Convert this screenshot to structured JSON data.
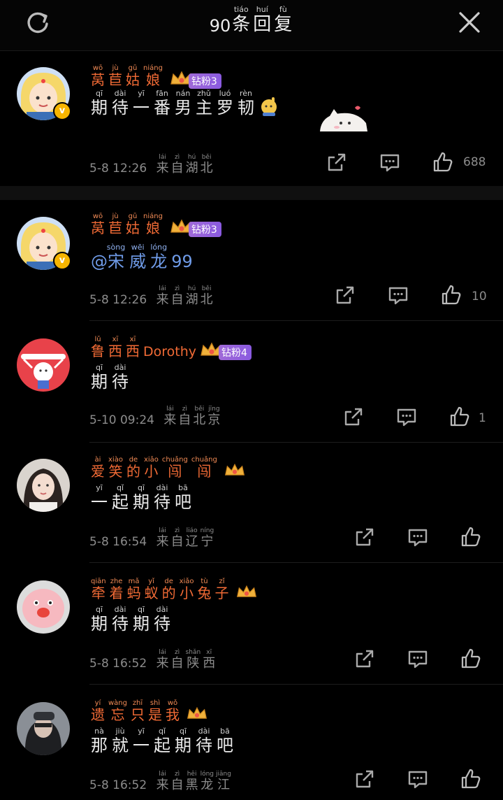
{
  "header": {
    "count": "90",
    "title": [
      {
        "ch": "条",
        "py": "tiáo"
      },
      {
        "ch": "回",
        "py": "huí"
      },
      {
        "ch": "复",
        "py": "fù"
      }
    ]
  },
  "comments": [
    {
      "name": [
        {
          "ch": "莴",
          "py": "wō"
        },
        {
          "ch": "苣",
          "py": "jù"
        },
        {
          "ch": "姑",
          "py": "gū"
        },
        {
          "ch": "娘",
          "py": "niáng"
        }
      ],
      "fan_badge": "钻粉3",
      "text": [
        {
          "ch": "期",
          "py": "qī"
        },
        {
          "ch": "待",
          "py": "dài"
        },
        {
          "ch": "一",
          "py": "yī"
        },
        {
          "ch": "番",
          "py": "fān"
        },
        {
          "ch": "男",
          "py": "nán"
        },
        {
          "ch": "主",
          "py": "zhǔ"
        },
        {
          "ch": "罗",
          "py": "luó"
        },
        {
          "ch": "韧",
          "py": "rèn"
        }
      ],
      "time": "5-8 12:26",
      "location": [
        {
          "ch": "来",
          "py": "lái"
        },
        {
          "ch": "自",
          "py": "zì"
        },
        {
          "ch": "湖",
          "py": "hú"
        },
        {
          "ch": "北",
          "py": "běi"
        }
      ],
      "likes": "688"
    },
    {
      "name": [
        {
          "ch": "莴",
          "py": "wō"
        },
        {
          "ch": "苣",
          "py": "jù"
        },
        {
          "ch": "姑",
          "py": "gū"
        },
        {
          "ch": "娘",
          "py": "niáng"
        }
      ],
      "fan_badge": "钻粉3",
      "text_prefix": "@",
      "text": [
        {
          "ch": "宋",
          "py": "sòng"
        },
        {
          "ch": "威",
          "py": "wēi"
        },
        {
          "ch": "龙",
          "py": "lóng"
        }
      ],
      "text_suffix": "99",
      "time": "5-8 12:26",
      "location": [
        {
          "ch": "来",
          "py": "lái"
        },
        {
          "ch": "自",
          "py": "zì"
        },
        {
          "ch": "湖",
          "py": "hú"
        },
        {
          "ch": "北",
          "py": "běi"
        }
      ],
      "likes": "10"
    },
    {
      "name": [
        {
          "ch": "鲁",
          "py": "lǔ"
        },
        {
          "ch": "西",
          "py": "xī"
        },
        {
          "ch": "西",
          "py": "xī"
        }
      ],
      "name_suffix": "Dorothy",
      "fan_badge": "钻粉4",
      "text": [
        {
          "ch": "期",
          "py": "qī"
        },
        {
          "ch": "待",
          "py": "dài"
        }
      ],
      "time": "5-10 09:24",
      "location": [
        {
          "ch": "来",
          "py": "lái"
        },
        {
          "ch": "自",
          "py": "zì"
        },
        {
          "ch": "北",
          "py": "běi"
        },
        {
          "ch": "京",
          "py": "jīng"
        }
      ],
      "likes": "1"
    },
    {
      "name": [
        {
          "ch": "爱",
          "py": "ài"
        },
        {
          "ch": "笑",
          "py": "xiào"
        },
        {
          "ch": "的",
          "py": "de"
        },
        {
          "ch": "小",
          "py": "xiǎo"
        },
        {
          "ch": "闯",
          "py": "chuǎng"
        },
        {
          "ch": "闯",
          "py": "chuǎng"
        }
      ],
      "text": [
        {
          "ch": "一",
          "py": "yī"
        },
        {
          "ch": "起",
          "py": "qǐ"
        },
        {
          "ch": "期",
          "py": "qī"
        },
        {
          "ch": "待",
          "py": "dài"
        },
        {
          "ch": "吧",
          "py": "bā"
        }
      ],
      "time": "5-8 16:54",
      "location": [
        {
          "ch": "来",
          "py": "lái"
        },
        {
          "ch": "自",
          "py": "zì"
        },
        {
          "ch": "辽",
          "py": "liáo"
        },
        {
          "ch": "宁",
          "py": "níng"
        }
      ],
      "likes": ""
    },
    {
      "name": [
        {
          "ch": "牵",
          "py": "qiān"
        },
        {
          "ch": "着",
          "py": "zhe"
        },
        {
          "ch": "蚂",
          "py": "mǎ"
        },
        {
          "ch": "蚁",
          "py": "yǐ"
        },
        {
          "ch": "的",
          "py": "de"
        },
        {
          "ch": "小",
          "py": "xiǎo"
        },
        {
          "ch": "兔",
          "py": "tù"
        },
        {
          "ch": "子",
          "py": "zǐ"
        }
      ],
      "text": [
        {
          "ch": "期",
          "py": "qī"
        },
        {
          "ch": "待",
          "py": "dài"
        },
        {
          "ch": "期",
          "py": "qī"
        },
        {
          "ch": "待",
          "py": "dài"
        }
      ],
      "time": "5-8 16:52",
      "location": [
        {
          "ch": "来",
          "py": "lái"
        },
        {
          "ch": "自",
          "py": "zì"
        },
        {
          "ch": "陕",
          "py": "shǎn"
        },
        {
          "ch": "西",
          "py": "xī"
        }
      ],
      "likes": ""
    },
    {
      "name": [
        {
          "ch": "遗",
          "py": "yí"
        },
        {
          "ch": "忘",
          "py": "wàng"
        },
        {
          "ch": "只",
          "py": "zhī"
        },
        {
          "ch": "是",
          "py": "shì"
        },
        {
          "ch": "我",
          "py": "wǒ"
        }
      ],
      "text": [
        {
          "ch": "那",
          "py": "nà"
        },
        {
          "ch": "就",
          "py": "jiù"
        },
        {
          "ch": "一",
          "py": "yī"
        },
        {
          "ch": "起",
          "py": "qǐ"
        },
        {
          "ch": "期",
          "py": "qī"
        },
        {
          "ch": "待",
          "py": "dài"
        },
        {
          "ch": "吧",
          "py": "bā"
        }
      ],
      "time": "5-8 16:52",
      "location": [
        {
          "ch": "来",
          "py": "lái"
        },
        {
          "ch": "自",
          "py": "zì"
        },
        {
          "ch": "黑",
          "py": "hēi"
        },
        {
          "ch": "龙",
          "py": "lóng"
        },
        {
          "ch": "江",
          "py": "jiāng"
        }
      ],
      "likes": ""
    }
  ],
  "icons": {
    "refresh": "refresh-icon",
    "close": "close-icon",
    "share": "share-icon",
    "reply": "reply-icon",
    "like": "thumbs-up-icon"
  },
  "colors": {
    "background": "#000000",
    "username": "#f06a35",
    "mention": "#6f9be8",
    "meta": "#8c8c8c",
    "fan_badge": "#8a5ae0"
  }
}
